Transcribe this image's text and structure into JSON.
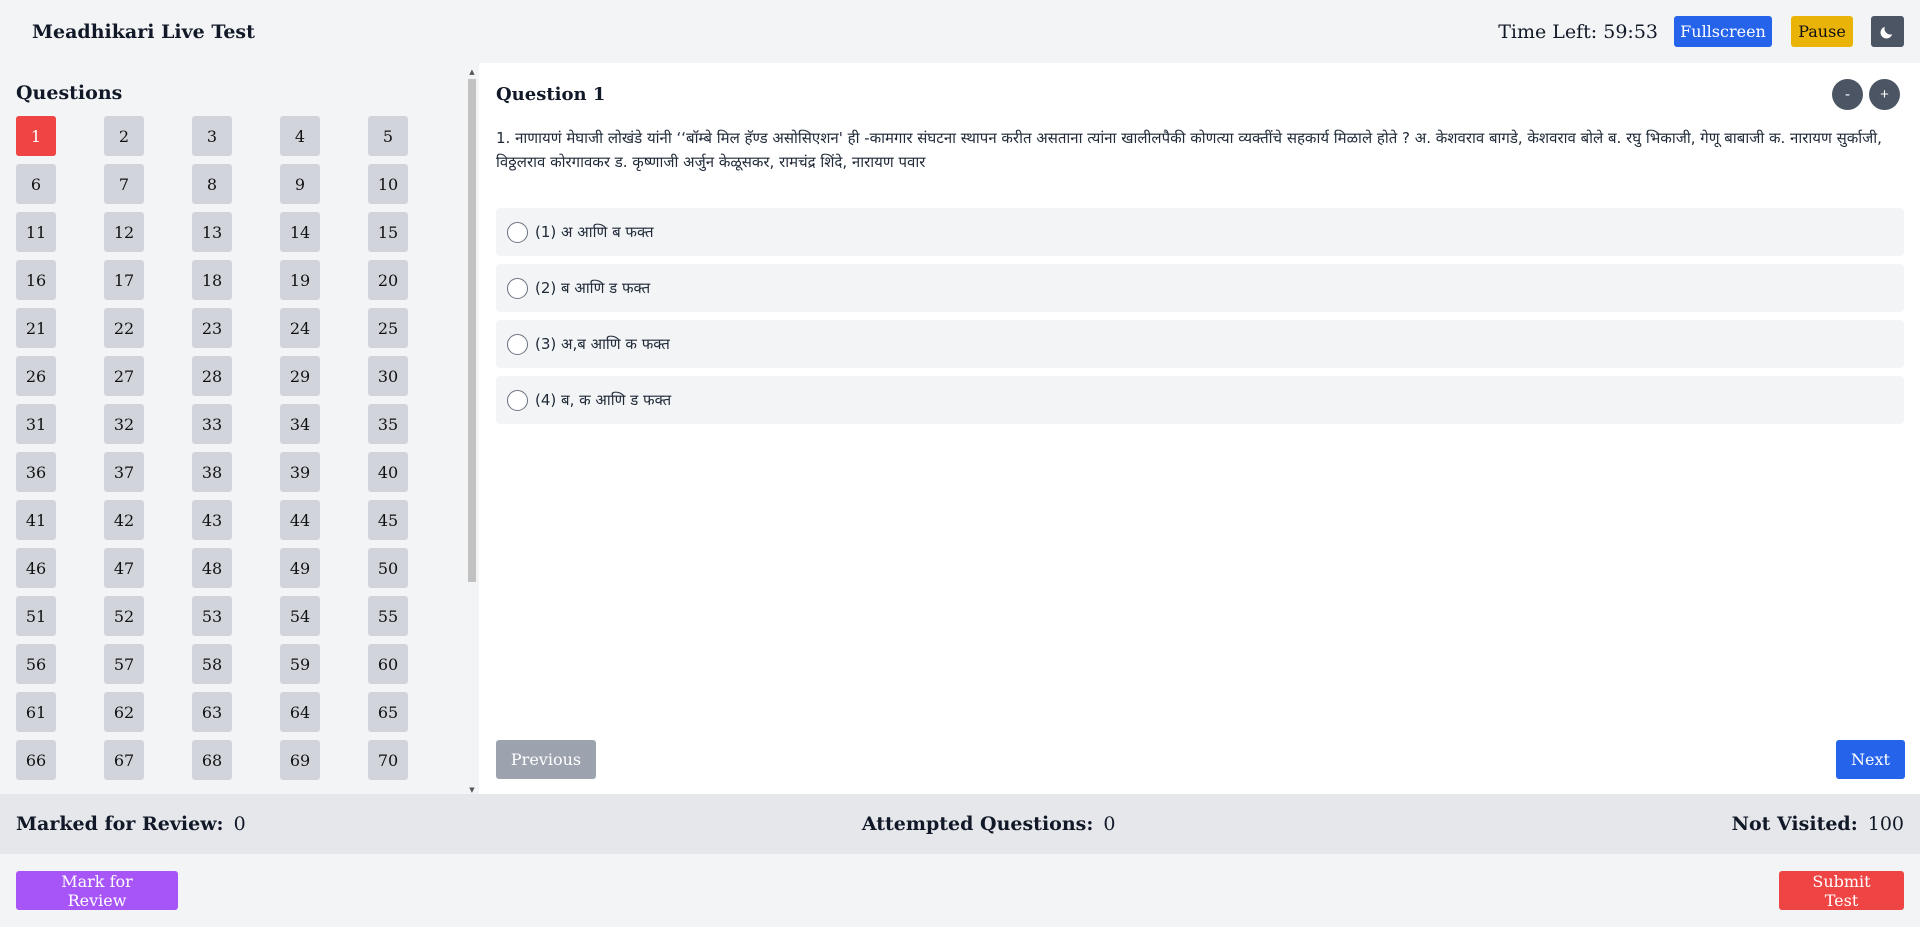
{
  "header": {
    "title": "Meadhikari Live Test",
    "timer": "Time Left: 59:53",
    "fullscreen_label": "Fullscreen",
    "pause_label": "Pause",
    "theme_icon": "moon-icon"
  },
  "sidebar": {
    "title": "Questions",
    "current": 1,
    "visible_question_numbers": [
      1,
      2,
      3,
      4,
      5,
      6,
      7,
      8,
      9,
      10,
      11,
      12,
      13,
      14,
      15,
      16,
      17,
      18,
      19,
      20,
      21,
      22,
      23,
      24,
      25,
      26,
      27,
      28,
      29,
      30,
      31,
      32,
      33,
      34,
      35,
      36,
      37,
      38,
      39,
      40,
      41,
      42,
      43,
      44,
      45,
      46,
      47,
      48,
      49,
      50,
      51,
      52,
      53,
      54,
      55,
      56,
      57,
      58,
      59,
      60,
      61,
      62,
      63,
      64,
      65,
      66,
      67,
      68,
      69,
      70
    ]
  },
  "question": {
    "title": "Question 1",
    "zoom_out_label": "-",
    "zoom_in_label": "+",
    "text": "1. नाणायणं मेघाजी लोखंडे यांनी ‘‘बॉम्बे मिल हॅण्ड असोसिएशन' ही -कामगार संघटना स्थापन करीत असताना त्यांना खालीलपैकी कोणत्या व्यक्तींचे सहकार्य मिळाले होते ? अ. केशवराव बागडे, केशवराव बोले ब. रघु भिकाजी, गेणू बाबाजी क. नारायण सुर्काजी, विठ्ठलराव कोरगावकर ड. कृष्णाजी अर्जुन केळूसकर, रामचंद्र शिंदे, नारायण पवार",
    "options": [
      "(1) अ आणि ब फक्त",
      "(2) ब आणि ड फक्त",
      "(3) अ,ब आणि क फक्त",
      "(4) ब, क आणि ड फक्त"
    ],
    "previous_label": "Previous",
    "next_label": "Next"
  },
  "stats": {
    "marked_label": "Marked for Review:",
    "marked_value": "0",
    "attempted_label": "Attempted Questions:",
    "attempted_value": "0",
    "not_visited_label": "Not Visited:",
    "not_visited_value": "100"
  },
  "footer": {
    "mark_label": "Mark for Review",
    "submit_label": "Submit Test"
  },
  "colors": {
    "current_question": "#ef4444",
    "primary": "#2563eb",
    "pause": "#eab308",
    "mark": "#a855f7",
    "submit": "#ef4444"
  }
}
